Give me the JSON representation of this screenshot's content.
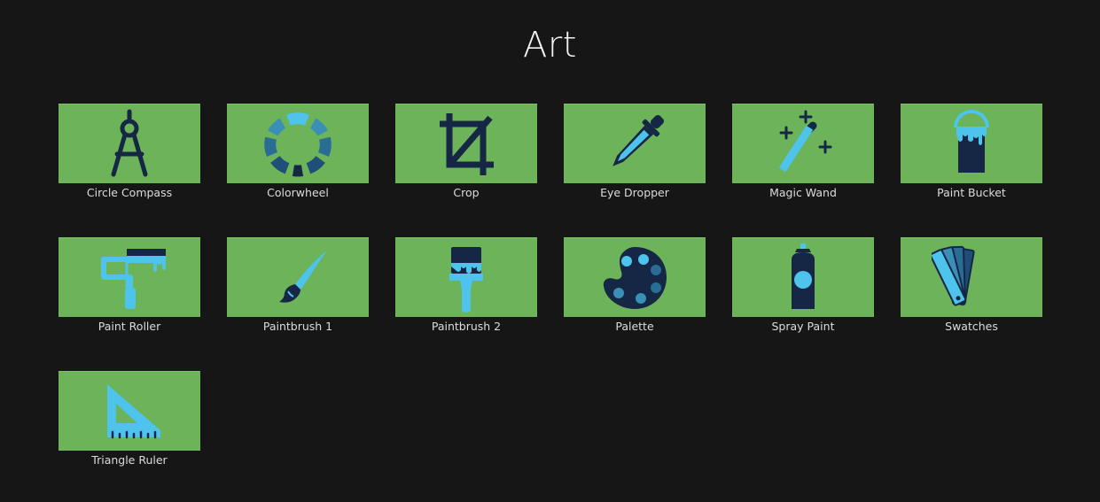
{
  "page": {
    "title": "Art"
  },
  "colors": {
    "background": "#161616",
    "tile": "#6db35a",
    "icon_dark": "#152744",
    "icon_light": "#4ec3ec",
    "label": "#dcdcdc"
  },
  "icons": [
    {
      "label": "Circle Compass",
      "icon": "circle-compass-icon"
    },
    {
      "label": "Colorwheel",
      "icon": "colorwheel-icon"
    },
    {
      "label": "Crop",
      "icon": "crop-icon"
    },
    {
      "label": "Eye Dropper",
      "icon": "eye-dropper-icon"
    },
    {
      "label": "Magic Wand",
      "icon": "magic-wand-icon"
    },
    {
      "label": "Paint Bucket",
      "icon": "paint-bucket-icon"
    },
    {
      "label": "Paint Roller",
      "icon": "paint-roller-icon"
    },
    {
      "label": "Paintbrush 1",
      "icon": "paintbrush-1-icon"
    },
    {
      "label": "Paintbrush 2",
      "icon": "paintbrush-2-icon"
    },
    {
      "label": "Palette",
      "icon": "palette-icon"
    },
    {
      "label": "Spray Paint",
      "icon": "spray-paint-icon"
    },
    {
      "label": "Swatches",
      "icon": "swatches-icon"
    },
    {
      "label": "Triangle Ruler",
      "icon": "triangle-ruler-icon"
    }
  ]
}
